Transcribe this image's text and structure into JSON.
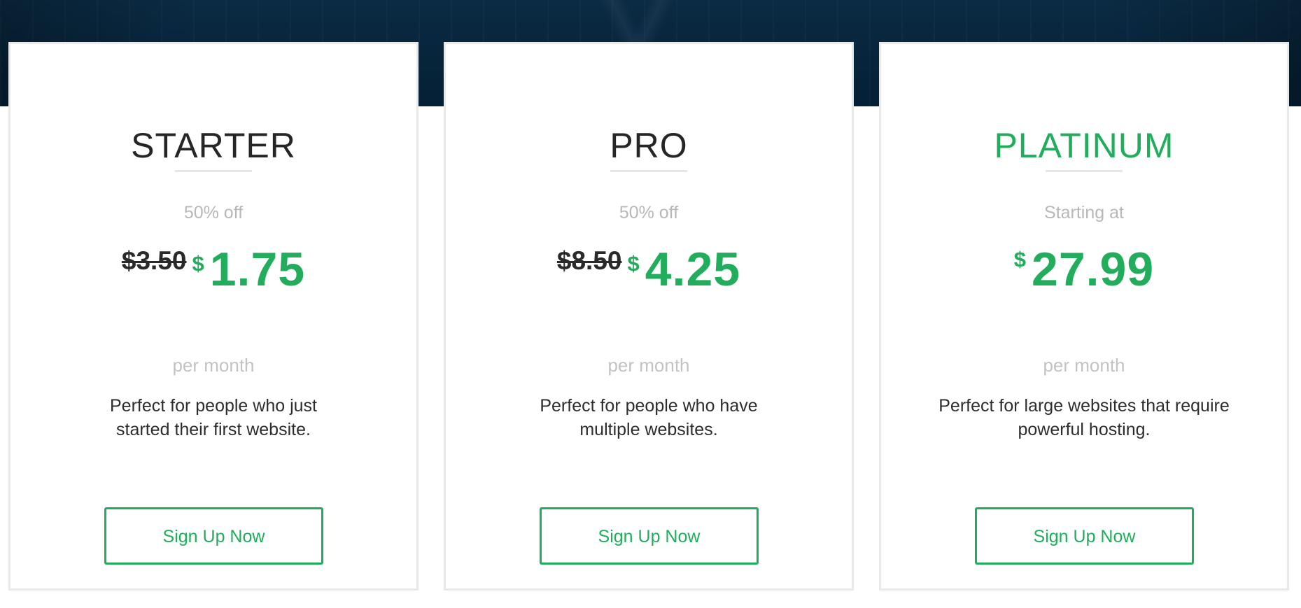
{
  "plans": [
    {
      "name": "STARTER",
      "subtitle": "50% off",
      "old_price": "$3.50",
      "currency": "$",
      "price": "1.75",
      "period": "per month",
      "description_line1": "Perfect for people who just",
      "description_line2": "started their first website.",
      "button_label": "Sign Up Now"
    },
    {
      "name": "PRO",
      "subtitle": "50% off",
      "old_price": "$8.50",
      "currency": "$",
      "price": "4.25",
      "period": "per month",
      "description_line1": "Perfect for people who have",
      "description_line2": "multiple websites.",
      "button_label": "Sign Up Now"
    },
    {
      "name": "PLATINUM",
      "subtitle": "Starting at",
      "currency": "$",
      "price": "27.99",
      "period": "per month",
      "description_line1": "Perfect for large websites that require",
      "description_line2": "powerful hosting.",
      "button_label": "Sign Up Now"
    }
  ],
  "colors": {
    "accent": "#22ad5c",
    "hero_background": "#06243a",
    "muted_text": "#b8b8b8",
    "body_text": "#2d2d2d",
    "card_border": "#e9e9e9"
  }
}
